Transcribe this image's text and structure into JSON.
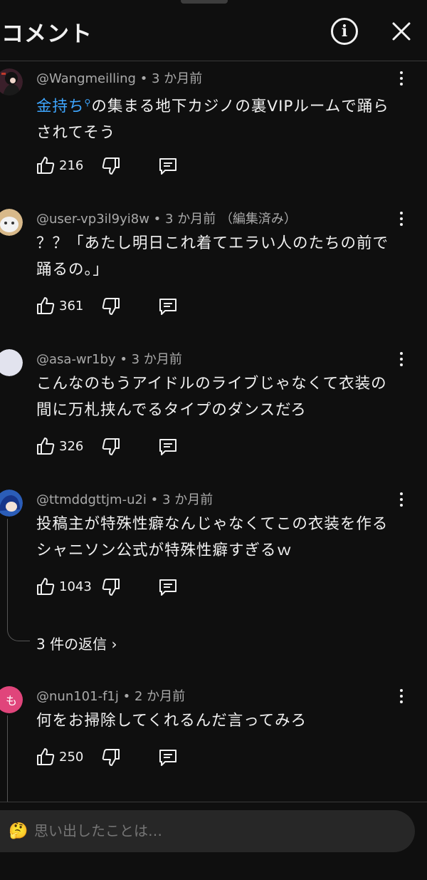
{
  "header": {
    "title": "コメント",
    "info_icon": "i",
    "close_icon": "close-icon"
  },
  "comments": [
    {
      "handle": "@Wangmeilling",
      "time": "3 か月前",
      "edited": "",
      "link_text": "金持ち",
      "text": "の集まる地下カジノの裏VIPルームで踊らされてそう",
      "likes": "216",
      "avatar_color": "#3a1f2a"
    },
    {
      "handle": "@user-vp3il9yi8w",
      "time": "3 か月前",
      "edited": "（編集済み）",
      "text": "？？「あたし明日これ着てエラい人のたちの前で踊るの。」",
      "likes": "361",
      "avatar_color": "#d8b98a"
    },
    {
      "handle": "@asa-wr1by",
      "time": "3 か月前",
      "edited": "",
      "text": "こんなのもうアイドルのライブじゃなくて衣装の間に万札挟んでるタイプのダンスだろ",
      "likes": "326",
      "avatar_color": "#e2e3ee"
    },
    {
      "handle": "@ttmddgttjm-u2i",
      "time": "3 か月前",
      "edited": "",
      "text": "投稿主が特殊性癖なんじゃなくてこの衣装を作るシャニソン公式が特殊性癖すぎるｗ",
      "likes": "1043",
      "avatar_color": "#2b5db8"
    },
    {
      "handle": "@nun101-f1j",
      "time": "2 か月前",
      "edited": "",
      "text": "何をお掃除してくれるんだ言ってみろ",
      "likes": "250",
      "avatar_color": "#e0457b",
      "avatar_letter": "も"
    }
  ],
  "replies_link": "3 件の返信",
  "input": {
    "emoji": "🤔",
    "placeholder": "思い出したことは…"
  },
  "colors": {
    "background": "#0f0f0f",
    "link": "#3ea6ff",
    "secondary_text": "#aaaaaa",
    "input_bg": "#272727"
  }
}
